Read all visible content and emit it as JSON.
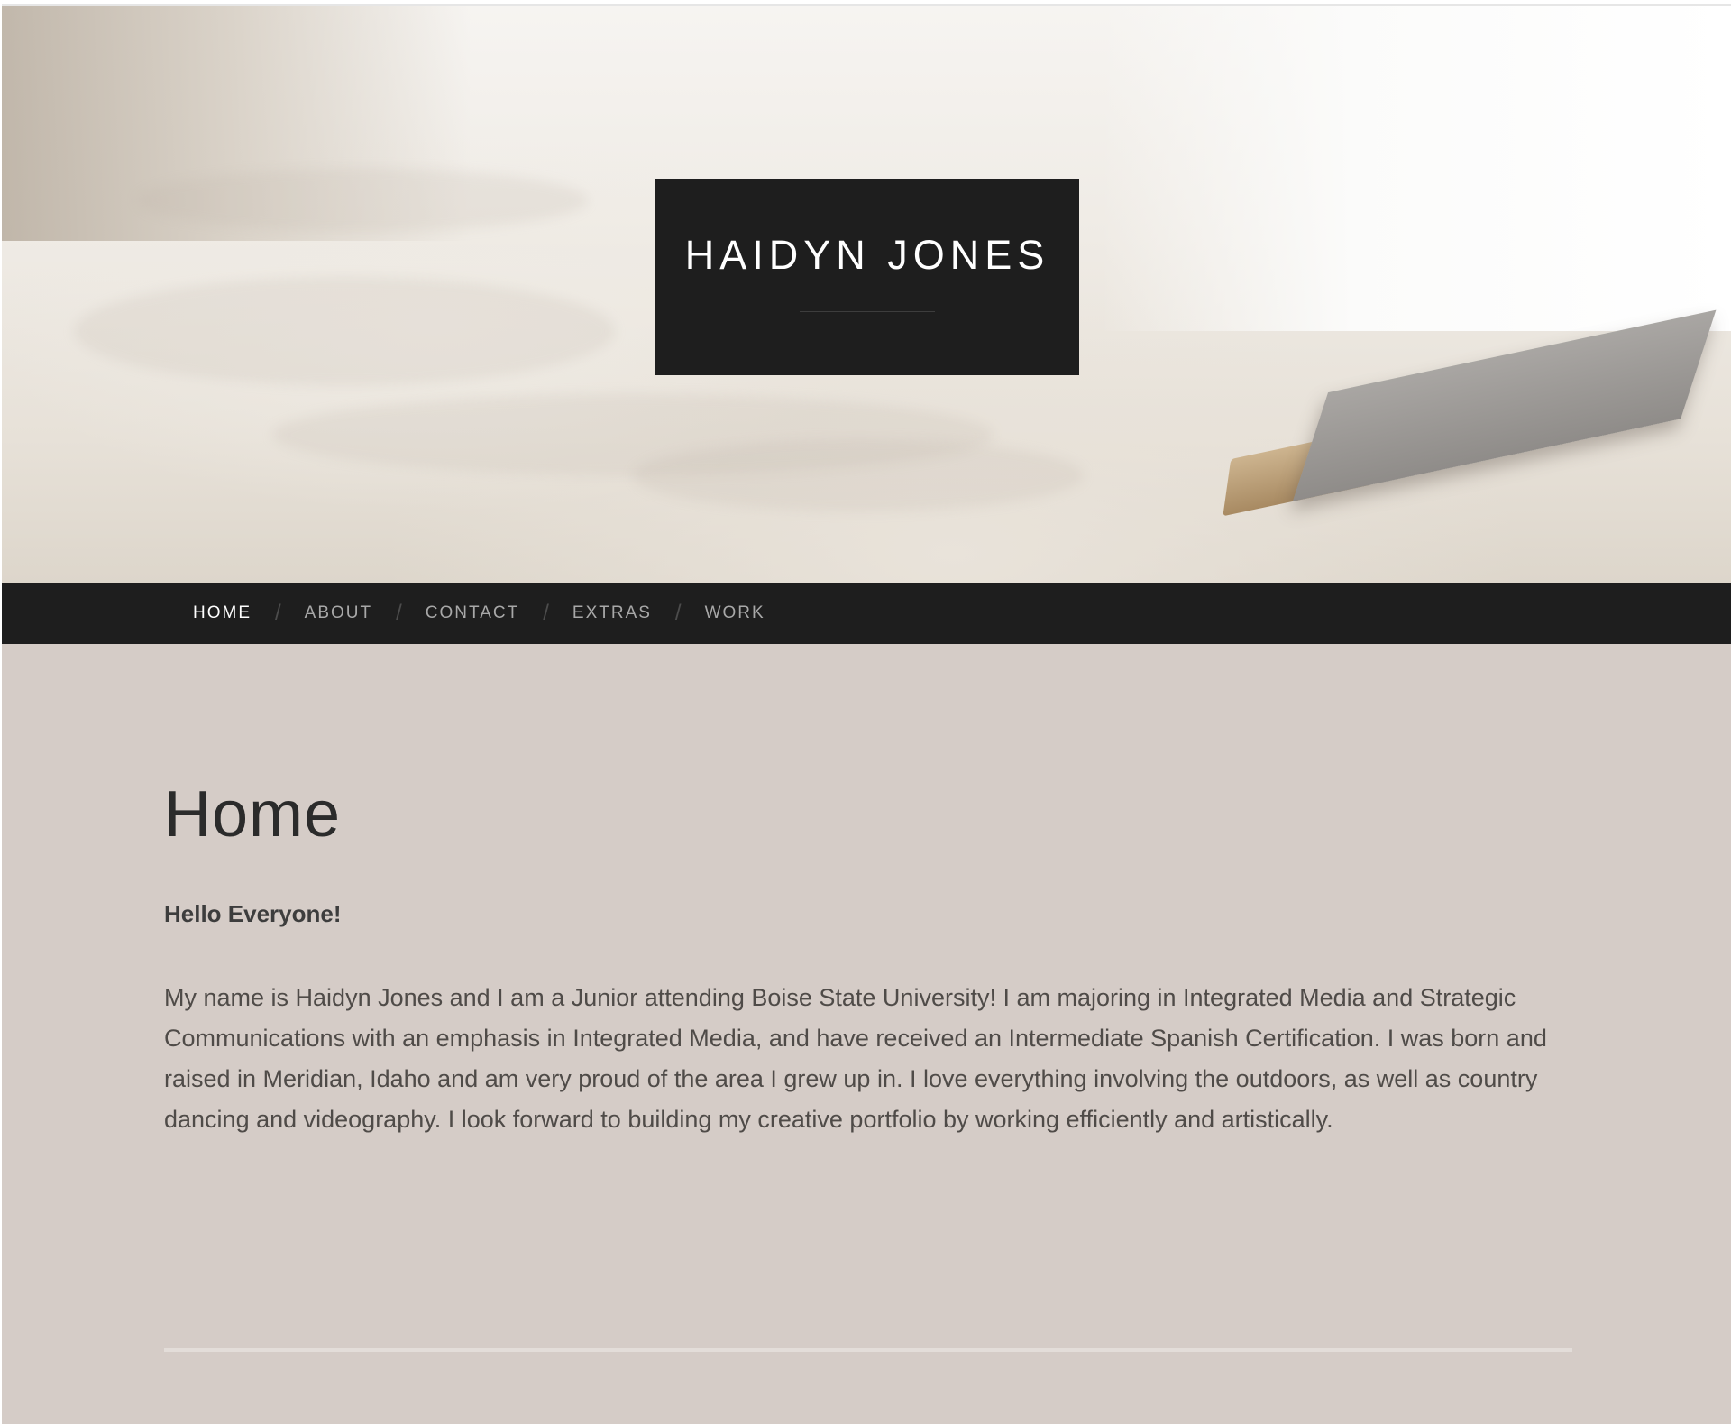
{
  "site": {
    "title": "HAIDYN JONES"
  },
  "nav": {
    "items": [
      {
        "label": "HOME",
        "active": true
      },
      {
        "label": "ABOUT"
      },
      {
        "label": "CONTACT"
      },
      {
        "label": "EXTRAS"
      },
      {
        "label": "WORK"
      }
    ],
    "separator": "/"
  },
  "main": {
    "page_title": "Home",
    "greeting": "Hello Everyone!",
    "bio": "My name is Haidyn Jones and I am a Junior attending Boise State University! I am majoring in Integrated Media and Strategic Communications with an emphasis in Integrated Media, and have received an Intermediate Spanish Certification. I was born and raised in Meridian, Idaho and am very proud of the area I grew up in. I love everything involving the outdoors, as well as country dancing and videography. I look forward to building my creative portfolio by working efficiently and artistically."
  },
  "colors": {
    "dark": "#1e1e1e",
    "content_bg": "#d5ccc7",
    "nav_text": "#a8a8a8",
    "nav_active": "#ffffff"
  }
}
